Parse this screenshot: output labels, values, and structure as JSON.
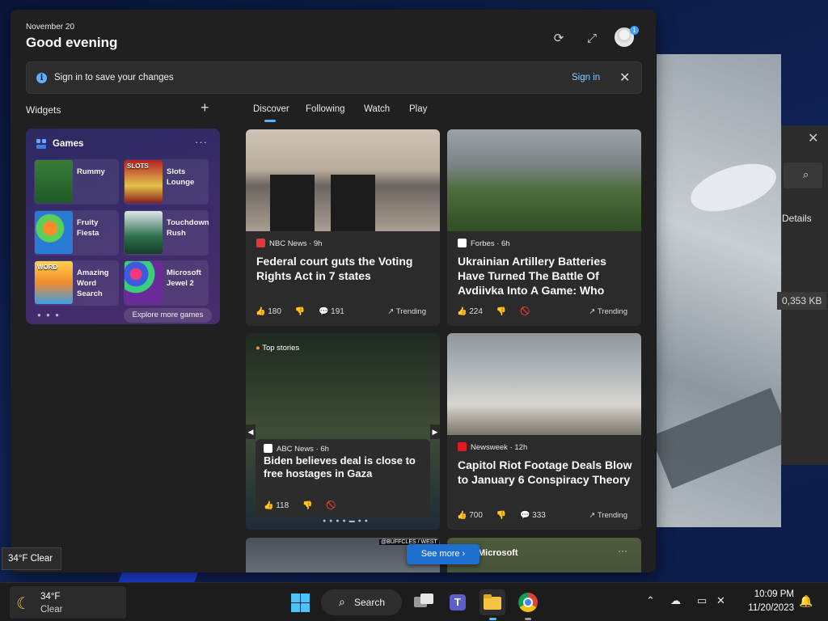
{
  "header": {
    "date": "November 20",
    "greeting": "Good evening",
    "profile_badge": "1"
  },
  "signin_banner": {
    "message": "Sign in to save your changes",
    "link": "Sign in"
  },
  "widgets": {
    "label": "Widgets",
    "games": {
      "title": "Games",
      "items": [
        {
          "name": "Rummy",
          "thumb_text": ""
        },
        {
          "name": "Slots Lounge",
          "thumb_text": "SLOTS"
        },
        {
          "name": "Fruity Fiesta",
          "thumb_text": ""
        },
        {
          "name": "Touchdown Rush",
          "thumb_text": ""
        },
        {
          "name": "Amazing Word Search",
          "thumb_text": "WORD"
        },
        {
          "name": "Microsoft Jewel 2",
          "thumb_text": ""
        }
      ],
      "explore": "Explore more games"
    }
  },
  "tabs": [
    "Discover",
    "Following",
    "Watch",
    "Play"
  ],
  "feed": {
    "cards": [
      {
        "source": "NBC News · 9h",
        "title": "Federal court guts the Voting Rights Act in 7 states",
        "likes": "180",
        "comments": "191",
        "trend": "Trending",
        "logo_color": "#e23a3a"
      },
      {
        "source": "Forbes · 6h",
        "title": "Ukrainian Artillery Batteries Have Turned The Battle Of Avdiivka Into A Game: Who Ca…",
        "likes": "224",
        "trend": "Trending",
        "logo_color": "#ffffff"
      },
      {
        "source": "ABC News · 6h",
        "title": "Biden believes deal is close to free hostages in Gaza",
        "likes": "118",
        "label": "Top stories",
        "logo_color": "#ffffff"
      },
      {
        "source": "Newsweek · 12h",
        "title": "Capitol Riot Footage Deals Blow to January 6 Conspiracy Theory",
        "likes": "700",
        "comments": "333",
        "trend": "Trending",
        "logo_color": "#e01b22"
      }
    ],
    "bottom_card_label": "Microsoft",
    "bottom_card_tag": "@BUFFCLES / WEST",
    "see_more": "See more"
  },
  "tooltip": "34°F Clear",
  "background_window": {
    "details": "Details",
    "size": "0,353 KB"
  },
  "taskbar": {
    "weather_temp": "34°F",
    "weather_cond": "Clear",
    "search_label": "Search",
    "time": "10:09 PM",
    "date": "11/20/2023"
  }
}
